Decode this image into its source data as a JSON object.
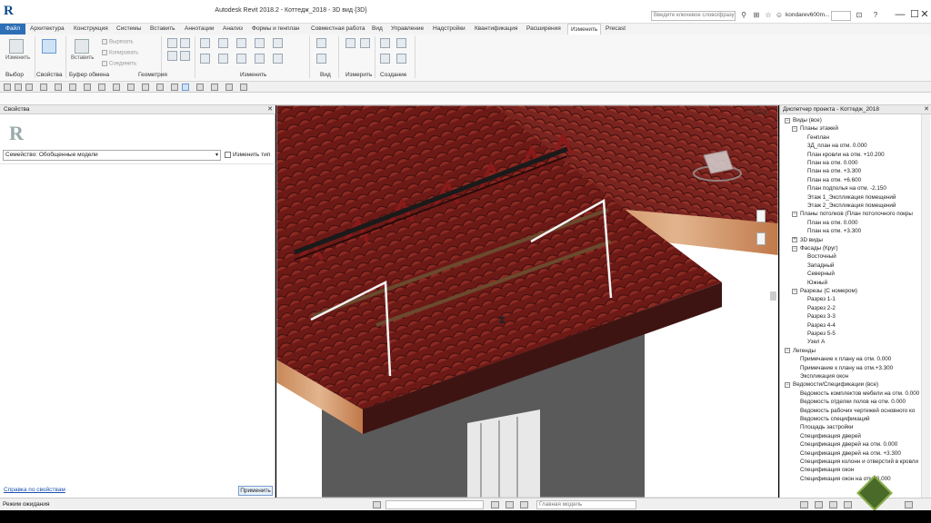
{
  "window": {
    "title": "Autodesk Revit 2018.2 -    Коттедж_2018 - 3D вид {3D}",
    "search_placeholder": "Введите ключевое слово/фразу",
    "user": "kondarev600m...",
    "minimize": "—",
    "maximize": "☐",
    "close": "✕"
  },
  "tabs": [
    {
      "label": "Файл"
    },
    {
      "label": "Архитектура"
    },
    {
      "label": "Конструкция"
    },
    {
      "label": "Системы"
    },
    {
      "label": "Вставить"
    },
    {
      "label": "Аннотации"
    },
    {
      "label": "Анализ"
    },
    {
      "label": "Формы и генплан"
    },
    {
      "label": "Совместная работа"
    },
    {
      "label": "Вид"
    },
    {
      "label": "Управление"
    },
    {
      "label": "Надстройки"
    },
    {
      "label": "Квантификация"
    },
    {
      "label": "Расширения"
    },
    {
      "label": "Изменить"
    },
    {
      "label": "Precast"
    }
  ],
  "ribbon": {
    "modify_label": "Изменить",
    "properties_label": "Свойства",
    "paste_label": "Вставить",
    "cut_label": "Вырезать",
    "copy_label": "Копировать",
    "join_label": "Соединить",
    "groups": {
      "select": "Выбор",
      "properties": "Свойства",
      "clipboard": "Буфер обмена",
      "geometry": "Геометрия",
      "modify": "Изменить",
      "view": "Вид",
      "measure": "Измерить",
      "create": "Создание"
    }
  },
  "properties_panel": {
    "title": "Свойства",
    "logo": "R",
    "family": "Семейство: Обобщенные модели",
    "edit_type": "Изменить тип",
    "help_link": "Справка по свойствам",
    "apply": "Применить"
  },
  "project_browser": {
    "title": "Диспетчер проекта - Коттедж_2018",
    "rows": [
      {
        "label": "Виды (все)",
        "toggle": "−"
      },
      {
        "label": "Планы этажей",
        "toggle": "−"
      },
      {
        "label": "Генплан"
      },
      {
        "label": "3Д_план на отм. 0.000"
      },
      {
        "label": "План кровли на отм. +10.200"
      },
      {
        "label": "План на отм. 0.000"
      },
      {
        "label": "План на отм. +3.300"
      },
      {
        "label": "План на отм. +6.600"
      },
      {
        "label": "План подполья на отм. -2.150"
      },
      {
        "label": "Этаж 1_Экспликация помещений"
      },
      {
        "label": "Этаж 2_Экспликация помещений"
      },
      {
        "label": "Планы потолков (План потолочного покры",
        "toggle": "−"
      },
      {
        "label": "План на отм. 0.000"
      },
      {
        "label": "План на отм. +3.300"
      },
      {
        "label": "3D виды",
        "toggle": "+"
      },
      {
        "label": "Фасады (Круг)",
        "toggle": "−"
      },
      {
        "label": "Восточный"
      },
      {
        "label": "Западный"
      },
      {
        "label": "Северный"
      },
      {
        "label": "Южный"
      },
      {
        "label": "Разрезы (С номером)",
        "toggle": "−"
      },
      {
        "label": "Разрез 1-1"
      },
      {
        "label": "Разрез 2-2"
      },
      {
        "label": "Разрез 3-3"
      },
      {
        "label": "Разрез 4-4"
      },
      {
        "label": "Разрез 5-5"
      },
      {
        "label": "Узел А"
      },
      {
        "label": "Легенды",
        "toggle": "−"
      },
      {
        "label": "Примечание к плану на отм. 0.000"
      },
      {
        "label": "Примечание к плану на отм.+3.300"
      },
      {
        "label": "Экспликация окон"
      },
      {
        "label": "Ведомости/Спецификации (все)",
        "toggle": "−"
      },
      {
        "label": "Ведомость комплектов мебели на отм. 0.000"
      },
      {
        "label": "Ведомость отделки полов на отм. 0.000"
      },
      {
        "label": "Ведомость рабочих чертежей основного ко"
      },
      {
        "label": "Ведомость спецификаций"
      },
      {
        "label": "Площадь застройки"
      },
      {
        "label": "Спецификация дверей"
      },
      {
        "label": "Спецификация дверей на отм. 0.000"
      },
      {
        "label": "Спецификация дверей на отм. +3.300"
      },
      {
        "label": "Спецификация колонн и отверстий в кровли"
      },
      {
        "label": "Спецификация окон"
      },
      {
        "label": "Спецификация окон на отм. 0.000"
      }
    ]
  },
  "status": {
    "text": "Режим ожидания",
    "model": "Главная модель"
  },
  "colors": {
    "file_tab": "#2c6fb6",
    "roof_tile": "#7a1f1c",
    "wall": "#555555",
    "fascia": "#d9a27a"
  }
}
